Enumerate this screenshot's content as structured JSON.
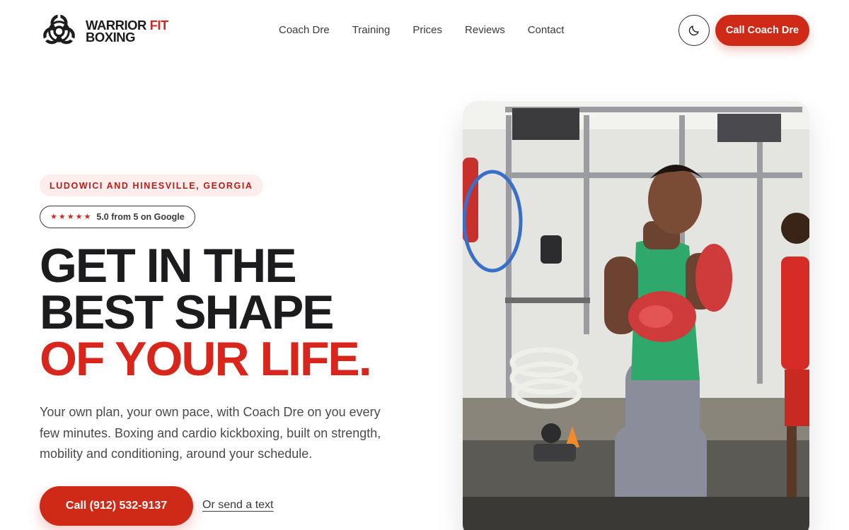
{
  "brand": {
    "name_line1_a": "WARRIOR",
    "name_line1_b": "FIT",
    "name_line2": "BOXING",
    "logo_icon": "biohazard-icon"
  },
  "nav": {
    "items": [
      {
        "label": "Coach Dre"
      },
      {
        "label": "Training"
      },
      {
        "label": "Prices"
      },
      {
        "label": "Reviews"
      },
      {
        "label": "Contact"
      }
    ]
  },
  "header": {
    "theme_icon": "moon-icon",
    "cta_label": "Call Coach Dre"
  },
  "hero": {
    "location": "LUDOWICI AND HINESVILLE, GEORGIA",
    "rating": {
      "stars": 5,
      "text": "5.0 from 5 on Google"
    },
    "headline_line1": "GET IN THE",
    "headline_line2": "BEST SHAPE",
    "headline_line3": "OF YOUR LIFE.",
    "lead": "Your own plan, your own pace, with Coach Dre on you every few minutes. Boxing and cardio kickboxing, built on strength, mobility and conditioning, around your schedule.",
    "cta_call": "Call (912) 532-9137",
    "cta_text": "Or send a text"
  },
  "colors": {
    "accent": "#d8261c",
    "button": "#cf2a17",
    "text": "#1c1c1e",
    "muted": "#4a4a4e"
  }
}
